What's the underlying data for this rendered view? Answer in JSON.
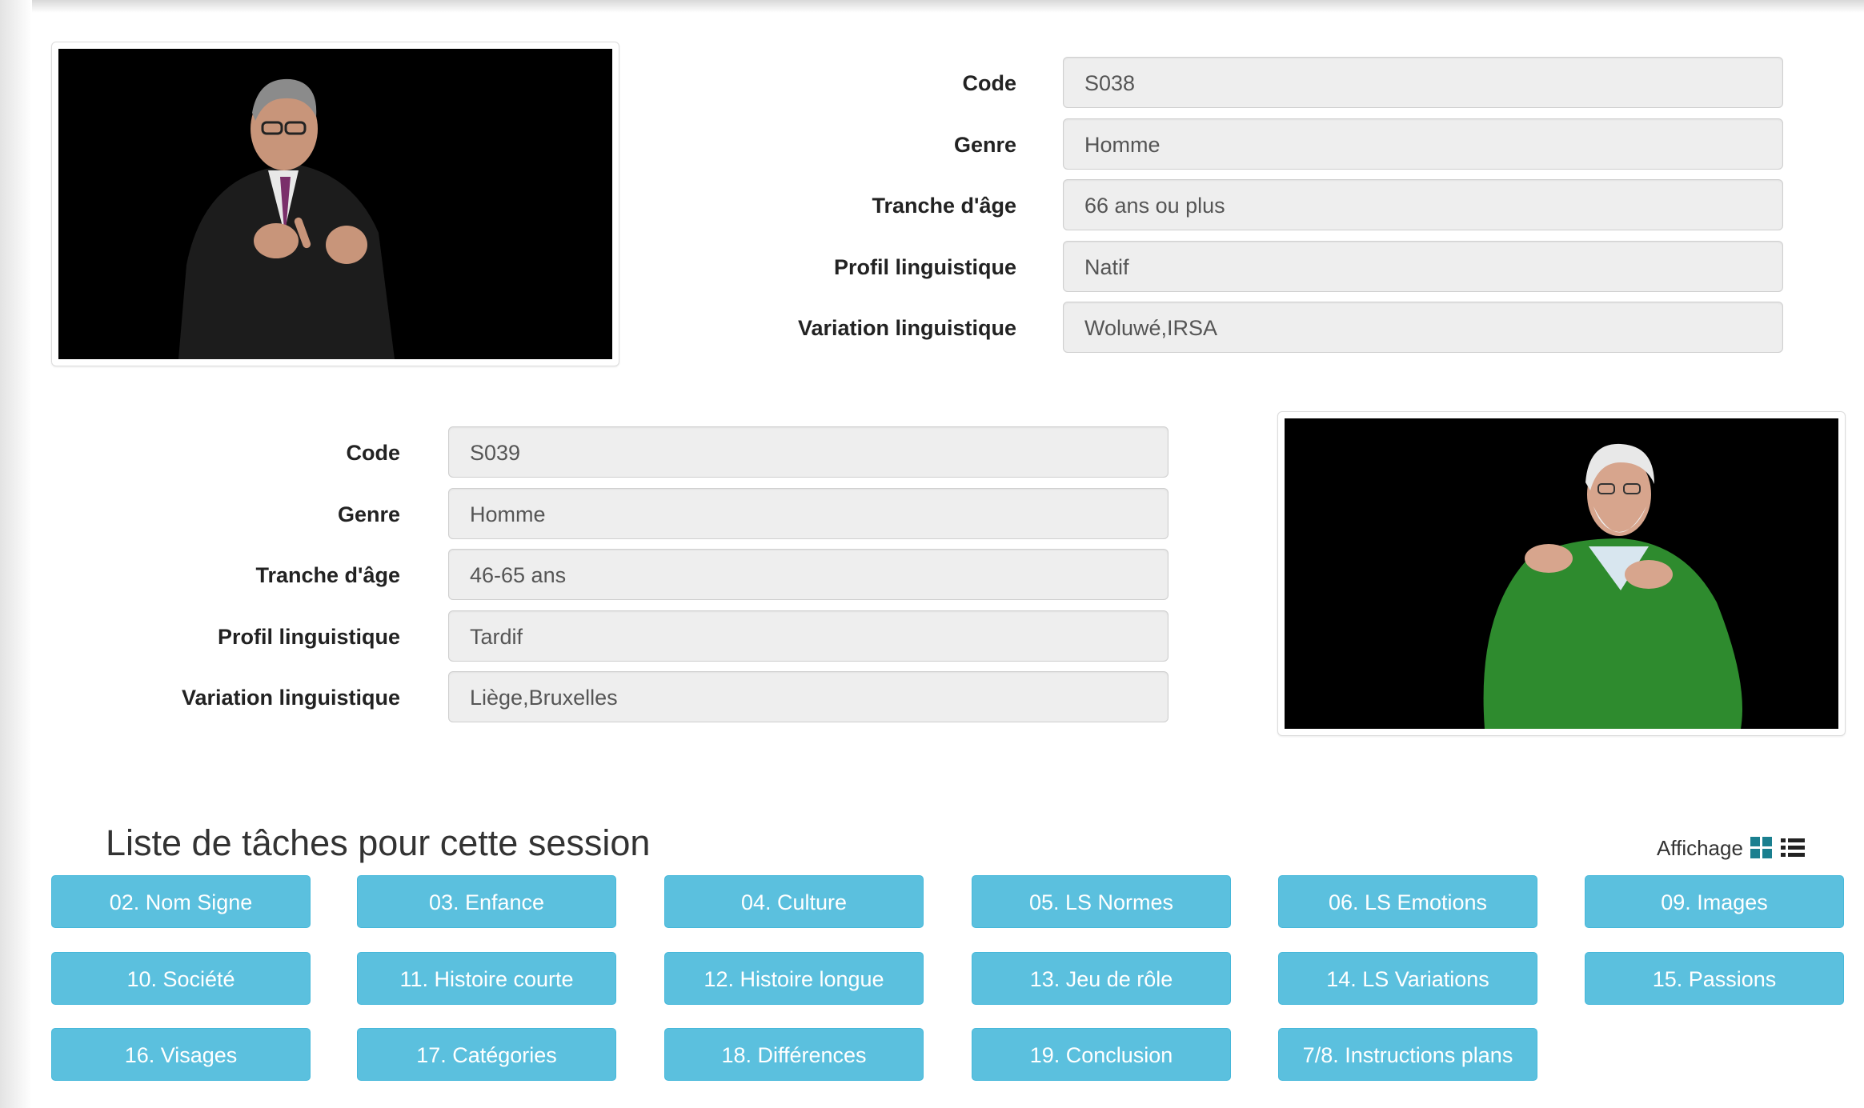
{
  "speaker1": {
    "fields": [
      {
        "label": "Code",
        "value": "S038"
      },
      {
        "label": "Genre",
        "value": "Homme"
      },
      {
        "label": "Tranche d'âge",
        "value": "66 ans ou plus"
      },
      {
        "label": "Profil linguistique",
        "value": "Natif"
      },
      {
        "label": "Variation linguistique",
        "value": "Woluwé,IRSA"
      }
    ]
  },
  "speaker2": {
    "fields": [
      {
        "label": "Code",
        "value": "S039"
      },
      {
        "label": "Genre",
        "value": "Homme"
      },
      {
        "label": "Tranche d'âge",
        "value": "46-65 ans"
      },
      {
        "label": "Profil linguistique",
        "value": "Tardif"
      },
      {
        "label": "Variation linguistique",
        "value": "Liège,Bruxelles"
      }
    ]
  },
  "tasks": {
    "title": "Liste de tâches pour cette session",
    "affichage_label": "Affichage",
    "affichage_color": "#1a7f8f",
    "buttons": [
      "02. Nom Signe",
      "03. Enfance",
      "04. Culture",
      "05. LS Normes",
      "06. LS Emotions",
      "09. Images",
      "10. Société",
      "11. Histoire courte",
      "12. Histoire longue",
      "13. Jeu de rôle",
      "14. LS Variations",
      "15. Passions",
      "16. Visages",
      "17. Catégories",
      "18. Différences",
      "19. Conclusion",
      "7/8. Instructions plans"
    ]
  },
  "colors": {
    "button_bg": "#5bc0de",
    "input_bg": "#eeeeee"
  }
}
